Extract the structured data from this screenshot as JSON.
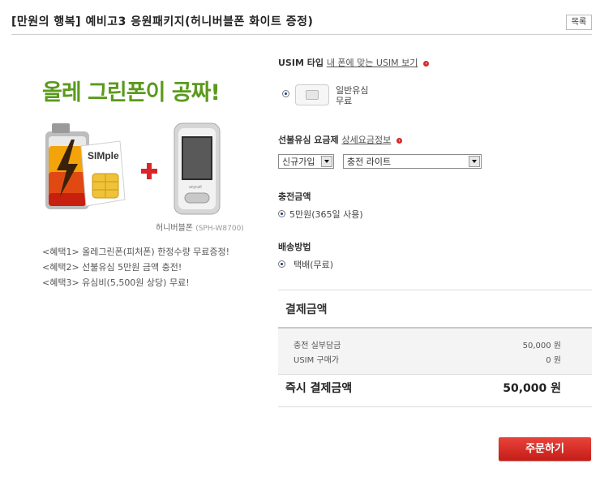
{
  "header": {
    "title": "[만원의 행복] 예비고3 응원패키지(허니버블폰 화이트 증정)",
    "list_button": "목록"
  },
  "promo": {
    "headline": "올레 그린폰이 공짜!",
    "sim_label": "SIMple",
    "phone_caption": "허니버블폰",
    "phone_model": "(SPH-W8700)",
    "phone_brand": "anycall",
    "benefits": [
      "<혜택1> 올레그린폰(피처폰) 한정수량 무료증정!",
      "<혜택2> 선불유심 5만원 금액 충전!",
      "<혜택3> 유심비(5,500원 상당) 무료!"
    ]
  },
  "usim": {
    "label": "USIM 타입",
    "link": "내 폰에 맞는 USIM 보기",
    "option_name": "일반유심",
    "option_price": "무료"
  },
  "plan": {
    "label": "선불유심 요금제",
    "link": "상세요금정보",
    "join_type": "신규가입",
    "plan_name": "충전 라이트"
  },
  "charge": {
    "label": "충전금액",
    "option": "5만원(365일 사용)"
  },
  "delivery": {
    "label": "배송방법",
    "option": "택배(무료)"
  },
  "payment": {
    "title": "결제금액",
    "rows": [
      {
        "label": "충전 실부담금",
        "value": "50,000 원"
      },
      {
        "label": "USIM 구매가",
        "value": "0 원"
      }
    ],
    "total_label": "즉시 결제금액",
    "total_value": "50,000 원"
  },
  "order_button": "주문하기",
  "colors": {
    "accent_red": "#d8262a",
    "headline_green": "#5a9a1c",
    "radio_blue": "#1a3e8a"
  }
}
